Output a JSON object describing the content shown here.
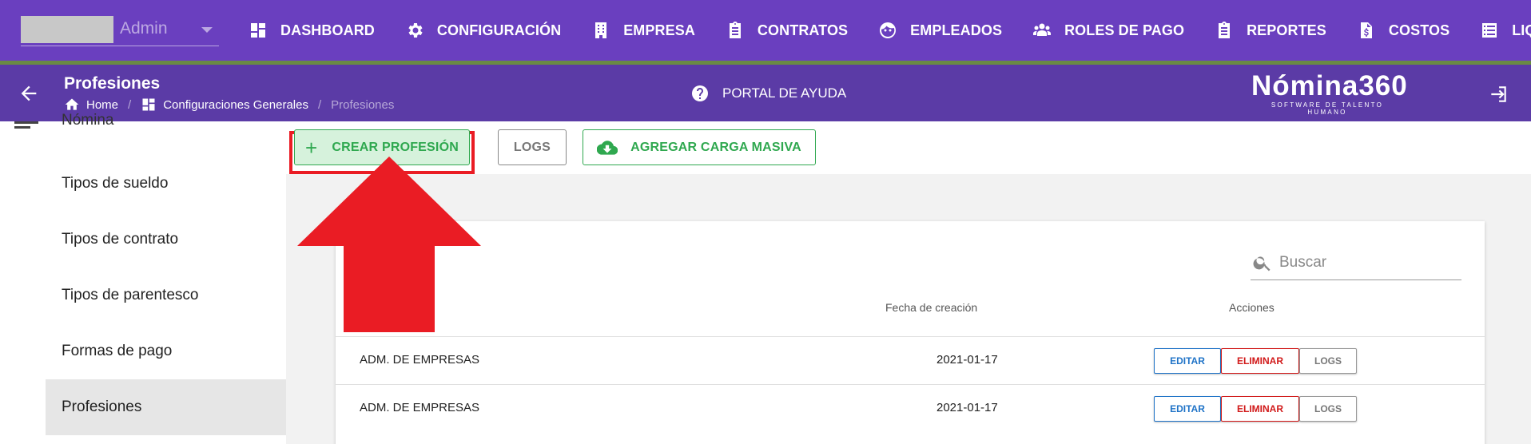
{
  "nav": {
    "user": {
      "name": "Admin"
    },
    "items": [
      {
        "label": "DASHBOARD",
        "icon": "dashboard-icon"
      },
      {
        "label": "CONFIGURACIÓN",
        "icon": "gear-icon"
      },
      {
        "label": "EMPRESA",
        "icon": "building-icon"
      },
      {
        "label": "CONTRATOS",
        "icon": "clipboard-icon"
      },
      {
        "label": "EMPLEADOS",
        "icon": "face-icon"
      },
      {
        "label": "ROLES DE PAGO",
        "icon": "people-icon"
      },
      {
        "label": "REPORTES",
        "icon": "clipboard-icon"
      },
      {
        "label": "COSTOS",
        "icon": "invoice-dollar-icon"
      },
      {
        "label": "LIQUIDACIONES",
        "icon": "list-icon"
      }
    ]
  },
  "header": {
    "title": "Profesiones",
    "breadcrumb": {
      "home": "Home",
      "section": "Configuraciones Generales",
      "current": "Profesiones"
    },
    "help": "PORTAL DE AYUDA",
    "logo": {
      "name": "Nómina360",
      "tagline": "SOFTWARE DE TALENTO HUMANO"
    }
  },
  "sidebar": {
    "partial_item": "Nómina",
    "items": [
      {
        "label": "Tipos de sueldo"
      },
      {
        "label": "Tipos de contrato"
      },
      {
        "label": "Tipos de parentesco"
      },
      {
        "label": "Formas de pago"
      },
      {
        "label": "Profesiones"
      }
    ],
    "active": "Profesiones"
  },
  "toolbar": {
    "crear_label": "CREAR PROFESIÓN",
    "logs_label": "LOGS",
    "masiva_label": "AGREGAR CARGA MASIVA"
  },
  "table": {
    "search_placeholder": "Buscar",
    "columns": {
      "fecha": "Fecha de creación",
      "acciones": "Acciones"
    },
    "actions": {
      "edit": "EDITAR",
      "delete": "ELIMINAR",
      "logs": "LOGS"
    },
    "rows": [
      {
        "name": "ADM. DE EMPRESAS",
        "date": "2021-01-17"
      },
      {
        "name": "ADM. DE EMPRESAS",
        "date": "2021-01-17"
      }
    ]
  },
  "colors": {
    "nav_bg": "#6a3fbf",
    "header_bg": "#5b3ba6",
    "accent_green": "#2fa84f",
    "annotation_red": "#ea1c24"
  }
}
